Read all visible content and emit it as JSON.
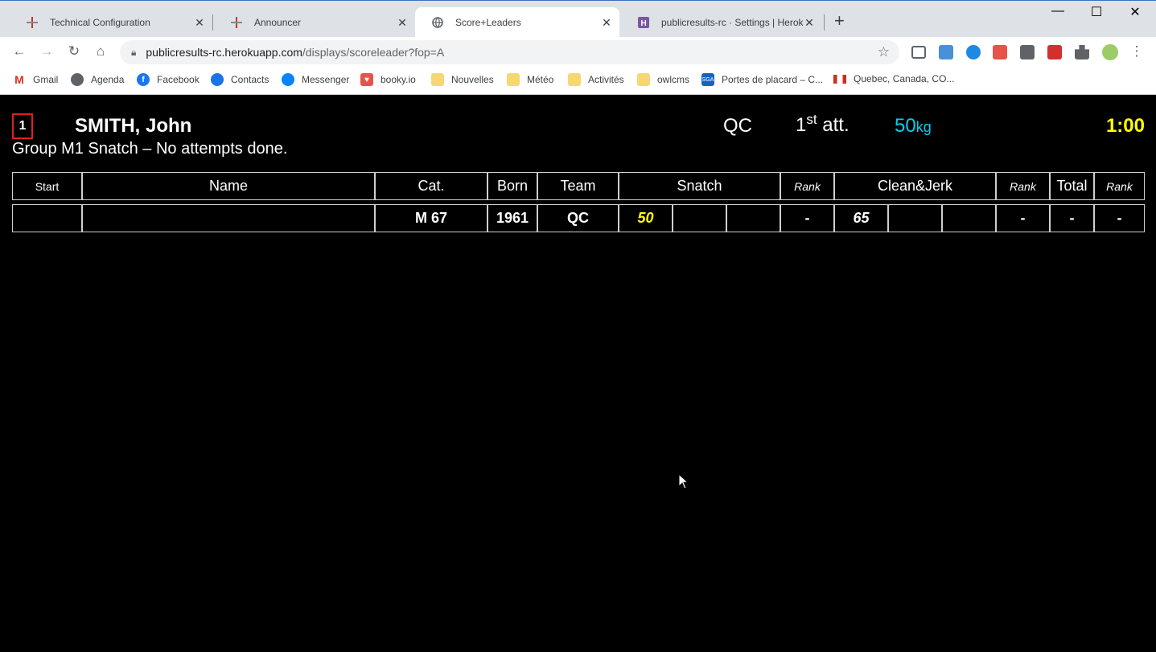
{
  "browser": {
    "tabs": [
      {
        "title": "Technical Configuration",
        "active": false
      },
      {
        "title": "Announcer",
        "active": false
      },
      {
        "title": "Score+Leaders",
        "active": true
      },
      {
        "title": "publicresults-rc · Settings | Heroku",
        "active": false
      }
    ],
    "url_host": "publicresults-rc.herokuapp.com",
    "url_path": "/displays/scoreleader?fop=A",
    "bookmarks": [
      "Gmail",
      "Agenda",
      "Facebook",
      "Contacts",
      "Messenger",
      "booky.io",
      "Nouvelles",
      "Météo",
      "Activités",
      "owlcms",
      "Portes de placard – C...",
      "Quebec, Canada, CO..."
    ]
  },
  "current": {
    "start_number": "1",
    "name": "SMITH, John",
    "team": "QC",
    "attempt_num": "1",
    "attempt_sup": "st",
    "attempt_label": "att.",
    "weight": "50",
    "weight_unit": "kg",
    "clock": "1:00",
    "group_info": "Group M1 Snatch – No attempts done."
  },
  "table": {
    "headers": {
      "start": "Start",
      "name": "Name",
      "cat": "Cat.",
      "born": "Born",
      "team": "Team",
      "snatch": "Snatch",
      "rank1": "Rank",
      "cj": "Clean&Jerk",
      "rank2": "Rank",
      "total": "Total",
      "rank3": "Rank"
    },
    "rows": [
      {
        "start": "",
        "name": "",
        "cat": "M 67",
        "born": "1961",
        "team": "QC",
        "sn1": "50",
        "sn2": "",
        "sn3": "",
        "sn_rank": "-",
        "cj1": "65",
        "cj2": "",
        "cj3": "",
        "cj_rank": "-",
        "total": "-",
        "total_rank": "-"
      }
    ]
  },
  "colors": {
    "background": "#000000",
    "timer": "#ffff00",
    "weight": "#00d0f0",
    "current_attempt": "#ffff00",
    "start_border": "#e02020"
  }
}
